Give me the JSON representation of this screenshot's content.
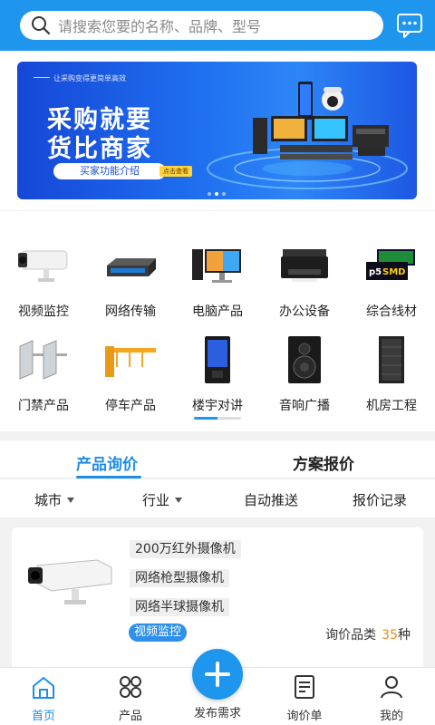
{
  "search": {
    "placeholder": "请搜索您要的名称、品牌、型号"
  },
  "banner": {
    "tagline": "让采购变得更简单高效",
    "title_line1": "采购就要",
    "title_line2": "货比商家",
    "cta": "买家功能介绍",
    "cta2": "点击查看",
    "slide_count": 3,
    "active_slide": 1
  },
  "categories": [
    {
      "label": "视频监控",
      "icon": "camera-icon"
    },
    {
      "label": "网络传输",
      "icon": "network-switch-icon"
    },
    {
      "label": "电脑产品",
      "icon": "computer-icon"
    },
    {
      "label": "办公设备",
      "icon": "printer-icon"
    },
    {
      "label": "综合线材",
      "icon": "led-display-icon"
    },
    {
      "label": "门禁产品",
      "icon": "turnstile-icon"
    },
    {
      "label": "停车产品",
      "icon": "parking-barrier-icon"
    },
    {
      "label": "楼宇对讲",
      "icon": "intercom-icon"
    },
    {
      "label": "音响广播",
      "icon": "speaker-icon"
    },
    {
      "label": "机房工程",
      "icon": "server-rack-icon"
    }
  ],
  "category_pager": {
    "progress": 0.5
  },
  "tabs": [
    {
      "label": "产品询价",
      "active": true
    },
    {
      "label": "方案报价",
      "active": false
    }
  ],
  "filters": [
    {
      "label": "城市",
      "dropdown": true
    },
    {
      "label": "行业",
      "dropdown": true
    },
    {
      "label": "自动推送",
      "dropdown": false
    },
    {
      "label": "报价记录",
      "dropdown": false
    }
  ],
  "product_card": {
    "items": [
      "200万红外摄像机",
      "网络枪型摄像机",
      "网络半球摄像机"
    ],
    "category_tag": "视频监控",
    "meta_label": "询价品类",
    "meta_count": "35",
    "meta_unit": "种"
  },
  "bottom_nav": [
    {
      "label": "首页",
      "icon": "home-icon",
      "active": true
    },
    {
      "label": "产品",
      "icon": "grid-icon",
      "active": false
    },
    {
      "label": "发布需求",
      "icon": "plus-icon",
      "active": false
    },
    {
      "label": "询价单",
      "icon": "list-doc-icon",
      "active": false
    },
    {
      "label": "我的",
      "icon": "user-icon",
      "active": false
    }
  ],
  "colors": {
    "primary": "#1e96ee",
    "accent_orange": "#f08a1c",
    "tab_active": "#1e8ee8"
  }
}
